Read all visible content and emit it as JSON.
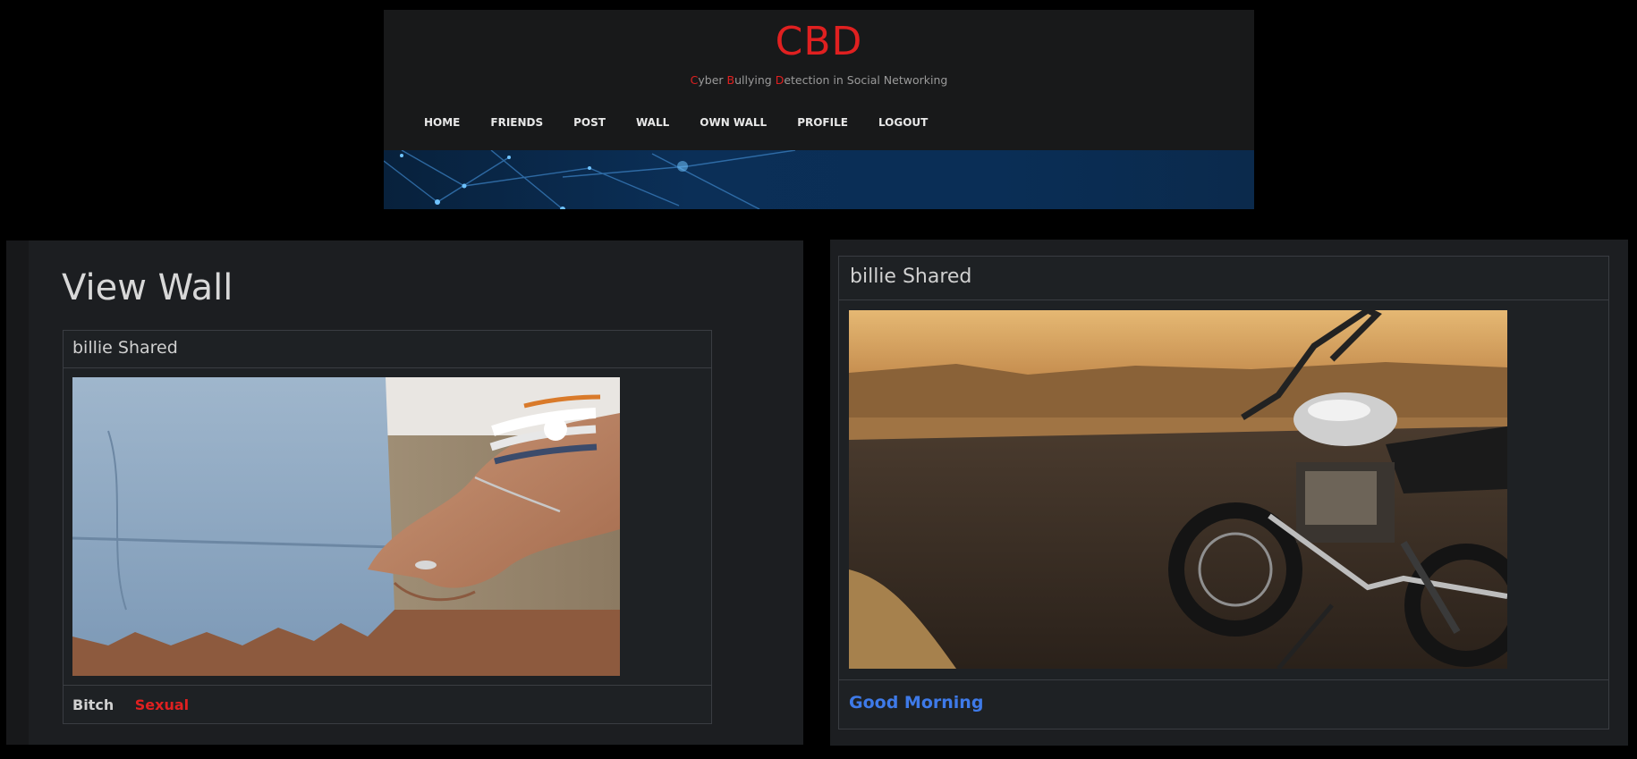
{
  "site": {
    "title": "CBD",
    "subtitle_parts": [
      {
        "text": "C",
        "highlight": true
      },
      {
        "text": "yber ",
        "highlight": false
      },
      {
        "text": "B",
        "highlight": true
      },
      {
        "text": "ullying ",
        "highlight": false
      },
      {
        "text": "D",
        "highlight": true
      },
      {
        "text": "etection in Social Networking",
        "highlight": false
      }
    ]
  },
  "nav": {
    "home": "HOME",
    "friends": "FRIENDS",
    "post": "POST",
    "wall": "WALL",
    "own_wall": "OWN WALL",
    "profile": "PROFILE",
    "logout": "LOGOUT"
  },
  "page": {
    "title": "View Wall"
  },
  "posts": [
    {
      "header": "billie Shared",
      "caption": "Bitch",
      "tag": "Sexual",
      "photo": "denim-shorts-wrist-bands-photo"
    },
    {
      "header": "billie Shared",
      "caption": "Good Morning",
      "photo": "motorcycle-sunset-road-photo"
    }
  ],
  "colors": {
    "accent_red": "#e02020",
    "caption_blue": "#3e7ae8",
    "panel_bg": "#1c1e21",
    "header_bg": "#18191a"
  }
}
